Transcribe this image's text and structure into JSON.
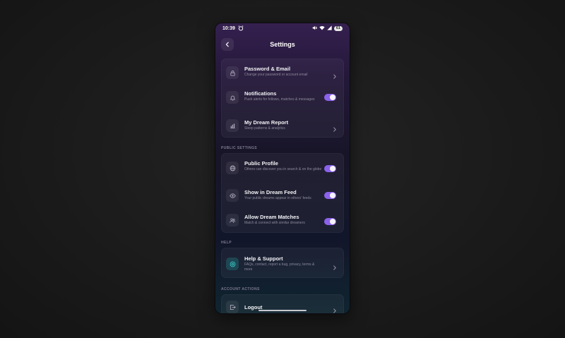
{
  "status_bar": {
    "time": "10:39",
    "battery": "61",
    "icons": [
      "alarm-icon",
      "mute-icon",
      "wifi-icon",
      "signal-icon",
      "battery-icon"
    ]
  },
  "header": {
    "title": "Settings",
    "back_icon": "chevron-left-icon"
  },
  "account_card": {
    "items": [
      {
        "title": "Password & Email",
        "subtitle": "Change your password or account email",
        "icon": "lock-icon",
        "control": "chevron"
      },
      {
        "title": "Notifications",
        "subtitle": "Push alerts for follows, matches & messages",
        "icon": "bell-icon",
        "control": "toggle",
        "on": true
      },
      {
        "title": "My Dream Report",
        "subtitle": "Sleep patterns & analytics",
        "icon": "bar-chart-icon",
        "control": "chevron"
      }
    ]
  },
  "public_settings": {
    "label": "PUBLIC SETTINGS",
    "items": [
      {
        "title": "Public Profile",
        "subtitle": "Others can discover you in search & on the globe",
        "icon": "globe-icon",
        "control": "toggle",
        "on": true
      },
      {
        "title": "Show in Dream Feed",
        "subtitle": "Your public dreams appear in others' feeds",
        "icon": "eye-icon",
        "control": "toggle",
        "on": true
      },
      {
        "title": "Allow Dream Matches",
        "subtitle": "Match & connect with similar dreamers",
        "icon": "users-icon",
        "control": "toggle",
        "on": true
      }
    ]
  },
  "help": {
    "label": "HELP",
    "items": [
      {
        "title": "Help & Support",
        "subtitle": "FAQs, contact, report a bug, privacy, terms & more",
        "icon": "support-icon",
        "control": "chevron"
      }
    ]
  },
  "account_actions": {
    "label": "ACCOUNT ACTIONS",
    "items": [
      {
        "title": "Logout",
        "icon": "logout-icon",
        "control": "chevron"
      }
    ]
  },
  "colors": {
    "accent": "#8b62ea",
    "support_icon": "#3ac9c9"
  }
}
